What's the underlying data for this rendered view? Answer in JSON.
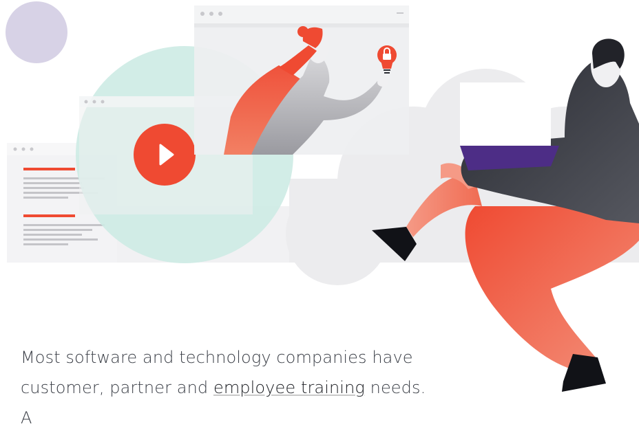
{
  "illustration": {
    "accent_color": "#ef4a32",
    "teal_color": "#cdebe4",
    "purple_color": "#4d2d86",
    "lavender_color": "#d7d2e6",
    "icons": [
      "play-icon",
      "lightbulb-lock-icon"
    ]
  },
  "intro": {
    "line1": "Most software and technology companies have",
    "line2_prefix": "customer, partner and ",
    "line2_link": "employee training",
    "line2_suffix": " needs. A"
  }
}
